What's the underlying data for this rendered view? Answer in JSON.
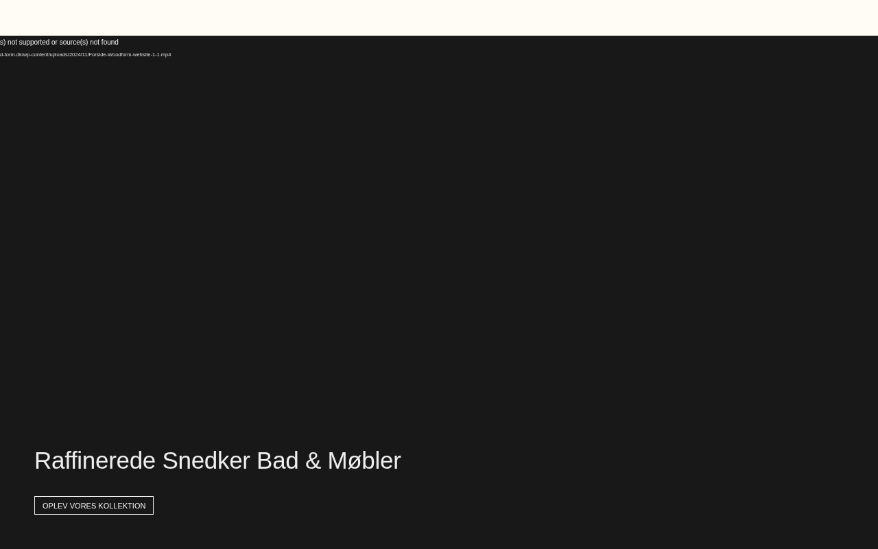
{
  "video_error": {
    "message": "s) not supported or source(s) not found",
    "source": "d-form.dk/wp-content/uploads/2024/11/Forside-Woodform-website-1-1.mp4"
  },
  "hero": {
    "heading": "Raffinerede Snedker Bad & Møbler",
    "button": "OPLEV VORES KOLLEKTION"
  }
}
